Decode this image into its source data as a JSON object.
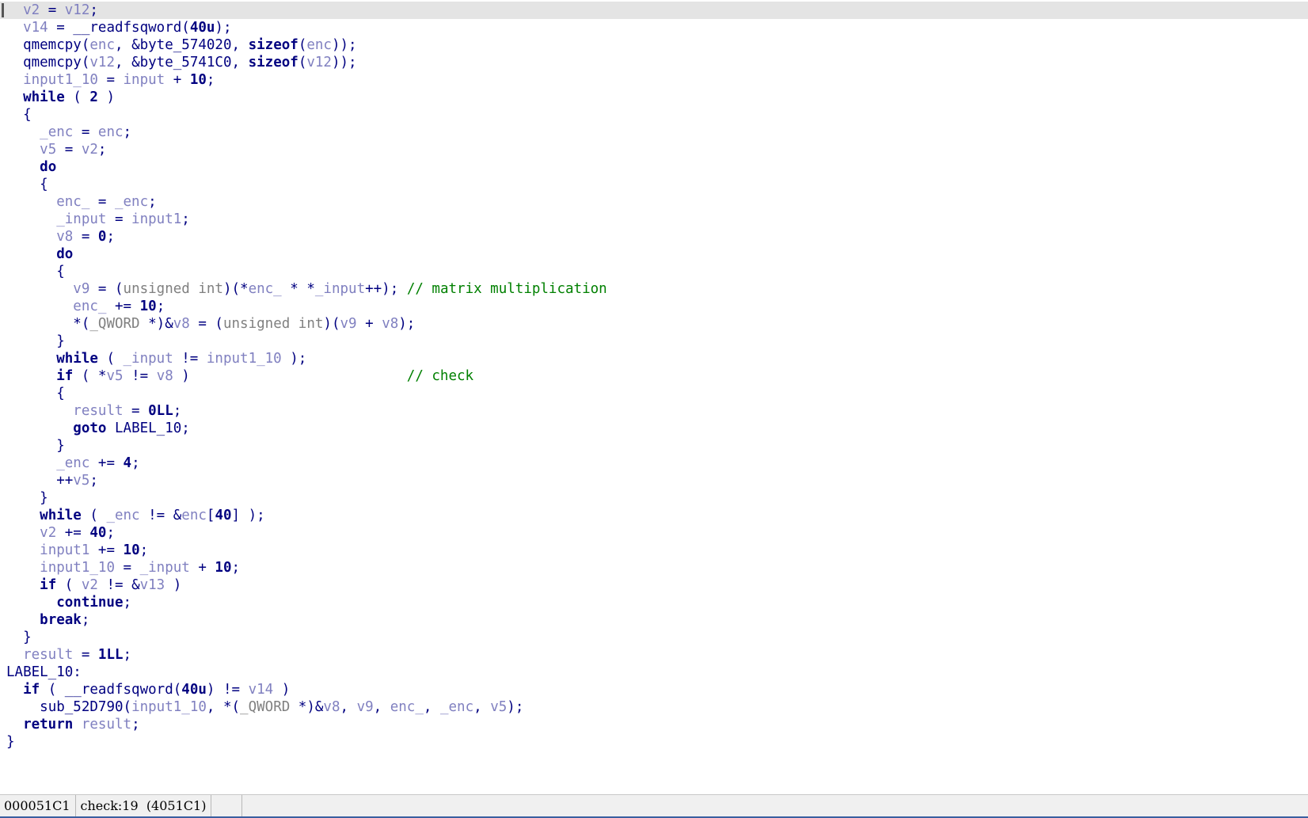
{
  "window": {
    "title": "IDA Pro - Pseudocode view",
    "background_color": "#ffffff",
    "current_line_highlight_color": "#e4e4e4"
  },
  "colors": {
    "default_text": "#000080",
    "local_variable": "#8080c0",
    "type": "#808080",
    "comment": "#008000",
    "keyword": "#000080",
    "status_bar_bg": "#f0f0f0",
    "status_bar_accent": "#3a5fa0"
  },
  "editor": {
    "current_line_index": 0,
    "caret_visible": true,
    "lines": [
      {
        "indent": 1,
        "tokens": [
          {
            "t": "var",
            "v": "v2"
          },
          {
            "t": "punct",
            "v": " = "
          },
          {
            "t": "var",
            "v": "v12"
          },
          {
            "t": "punct",
            "v": ";"
          }
        ]
      },
      {
        "indent": 1,
        "tokens": [
          {
            "t": "var",
            "v": "v14"
          },
          {
            "t": "punct",
            "v": " = "
          },
          {
            "t": "func",
            "v": "__readfsqword"
          },
          {
            "t": "punct",
            "v": "("
          },
          {
            "t": "num",
            "v": "40u"
          },
          {
            "t": "punct",
            "v": ");"
          }
        ]
      },
      {
        "indent": 1,
        "tokens": [
          {
            "t": "func",
            "v": "qmemcpy"
          },
          {
            "t": "punct",
            "v": "("
          },
          {
            "t": "var",
            "v": "enc"
          },
          {
            "t": "punct",
            "v": ", &"
          },
          {
            "t": "glob",
            "v": "byte_574020"
          },
          {
            "t": "punct",
            "v": ", "
          },
          {
            "t": "kw",
            "v": "sizeof"
          },
          {
            "t": "punct",
            "v": "("
          },
          {
            "t": "var",
            "v": "enc"
          },
          {
            "t": "punct",
            "v": "));"
          }
        ]
      },
      {
        "indent": 1,
        "tokens": [
          {
            "t": "func",
            "v": "qmemcpy"
          },
          {
            "t": "punct",
            "v": "("
          },
          {
            "t": "var",
            "v": "v12"
          },
          {
            "t": "punct",
            "v": ", &"
          },
          {
            "t": "glob",
            "v": "byte_5741C0"
          },
          {
            "t": "punct",
            "v": ", "
          },
          {
            "t": "kw",
            "v": "sizeof"
          },
          {
            "t": "punct",
            "v": "("
          },
          {
            "t": "var",
            "v": "v12"
          },
          {
            "t": "punct",
            "v": "));"
          }
        ]
      },
      {
        "indent": 1,
        "tokens": [
          {
            "t": "var",
            "v": "input1_10"
          },
          {
            "t": "punct",
            "v": " = "
          },
          {
            "t": "var",
            "v": "input"
          },
          {
            "t": "punct",
            "v": " + "
          },
          {
            "t": "num",
            "v": "10"
          },
          {
            "t": "punct",
            "v": ";"
          }
        ]
      },
      {
        "indent": 1,
        "tokens": [
          {
            "t": "kw",
            "v": "while"
          },
          {
            "t": "punct",
            "v": " ( "
          },
          {
            "t": "num",
            "v": "2"
          },
          {
            "t": "punct",
            "v": " )"
          }
        ]
      },
      {
        "indent": 1,
        "tokens": [
          {
            "t": "punct",
            "v": "{"
          }
        ]
      },
      {
        "indent": 2,
        "tokens": [
          {
            "t": "var",
            "v": "_enc"
          },
          {
            "t": "punct",
            "v": " = "
          },
          {
            "t": "var",
            "v": "enc"
          },
          {
            "t": "punct",
            "v": ";"
          }
        ]
      },
      {
        "indent": 2,
        "tokens": [
          {
            "t": "var",
            "v": "v5"
          },
          {
            "t": "punct",
            "v": " = "
          },
          {
            "t": "var",
            "v": "v2"
          },
          {
            "t": "punct",
            "v": ";"
          }
        ]
      },
      {
        "indent": 2,
        "tokens": [
          {
            "t": "kw",
            "v": "do"
          }
        ]
      },
      {
        "indent": 2,
        "tokens": [
          {
            "t": "punct",
            "v": "{"
          }
        ]
      },
      {
        "indent": 3,
        "tokens": [
          {
            "t": "var",
            "v": "enc_"
          },
          {
            "t": "punct",
            "v": " = "
          },
          {
            "t": "var",
            "v": "_enc"
          },
          {
            "t": "punct",
            "v": ";"
          }
        ]
      },
      {
        "indent": 3,
        "tokens": [
          {
            "t": "var",
            "v": "_input"
          },
          {
            "t": "punct",
            "v": " = "
          },
          {
            "t": "var",
            "v": "input1"
          },
          {
            "t": "punct",
            "v": ";"
          }
        ]
      },
      {
        "indent": 3,
        "tokens": [
          {
            "t": "var",
            "v": "v8"
          },
          {
            "t": "punct",
            "v": " = "
          },
          {
            "t": "num",
            "v": "0"
          },
          {
            "t": "punct",
            "v": ";"
          }
        ]
      },
      {
        "indent": 3,
        "tokens": [
          {
            "t": "kw",
            "v": "do"
          }
        ]
      },
      {
        "indent": 3,
        "tokens": [
          {
            "t": "punct",
            "v": "{"
          }
        ]
      },
      {
        "indent": 4,
        "comment": "// matrix multiplication",
        "comment_col": 48,
        "tokens": [
          {
            "t": "var",
            "v": "v9"
          },
          {
            "t": "punct",
            "v": " = ("
          },
          {
            "t": "type",
            "v": "unsigned int"
          },
          {
            "t": "punct",
            "v": ")(*"
          },
          {
            "t": "var",
            "v": "enc_"
          },
          {
            "t": "punct",
            "v": " * *"
          },
          {
            "t": "var",
            "v": "_input"
          },
          {
            "t": "punct",
            "v": "++);"
          }
        ]
      },
      {
        "indent": 4,
        "tokens": [
          {
            "t": "var",
            "v": "enc_"
          },
          {
            "t": "punct",
            "v": " += "
          },
          {
            "t": "num",
            "v": "10"
          },
          {
            "t": "punct",
            "v": ";"
          }
        ]
      },
      {
        "indent": 4,
        "tokens": [
          {
            "t": "punct",
            "v": "*("
          },
          {
            "t": "type",
            "v": "_QWORD"
          },
          {
            "t": "punct",
            "v": " *)&"
          },
          {
            "t": "var",
            "v": "v8"
          },
          {
            "t": "punct",
            "v": " = ("
          },
          {
            "t": "type",
            "v": "unsigned int"
          },
          {
            "t": "punct",
            "v": ")("
          },
          {
            "t": "var",
            "v": "v9"
          },
          {
            "t": "punct",
            "v": " + "
          },
          {
            "t": "var",
            "v": "v8"
          },
          {
            "t": "punct",
            "v": ");"
          }
        ]
      },
      {
        "indent": 3,
        "tokens": [
          {
            "t": "punct",
            "v": "}"
          }
        ]
      },
      {
        "indent": 3,
        "tokens": [
          {
            "t": "kw",
            "v": "while"
          },
          {
            "t": "punct",
            "v": " ( "
          },
          {
            "t": "var",
            "v": "_input"
          },
          {
            "t": "punct",
            "v": " != "
          },
          {
            "t": "var",
            "v": "input1_10"
          },
          {
            "t": "punct",
            "v": " );"
          }
        ]
      },
      {
        "indent": 3,
        "comment": "// check",
        "comment_col": 48,
        "tokens": [
          {
            "t": "kw",
            "v": "if"
          },
          {
            "t": "punct",
            "v": " ( *"
          },
          {
            "t": "var",
            "v": "v5"
          },
          {
            "t": "punct",
            "v": " != "
          },
          {
            "t": "var",
            "v": "v8"
          },
          {
            "t": "punct",
            "v": " )"
          }
        ]
      },
      {
        "indent": 3,
        "tokens": [
          {
            "t": "punct",
            "v": "{"
          }
        ]
      },
      {
        "indent": 4,
        "tokens": [
          {
            "t": "var",
            "v": "result"
          },
          {
            "t": "punct",
            "v": " = "
          },
          {
            "t": "num",
            "v": "0LL"
          },
          {
            "t": "punct",
            "v": ";"
          }
        ]
      },
      {
        "indent": 4,
        "tokens": [
          {
            "t": "kw",
            "v": "goto"
          },
          {
            "t": "punct",
            "v": " "
          },
          {
            "t": "label",
            "v": "LABEL_10"
          },
          {
            "t": "punct",
            "v": ";"
          }
        ]
      },
      {
        "indent": 3,
        "tokens": [
          {
            "t": "punct",
            "v": "}"
          }
        ]
      },
      {
        "indent": 3,
        "tokens": [
          {
            "t": "var",
            "v": "_enc"
          },
          {
            "t": "punct",
            "v": " += "
          },
          {
            "t": "num",
            "v": "4"
          },
          {
            "t": "punct",
            "v": ";"
          }
        ]
      },
      {
        "indent": 3,
        "tokens": [
          {
            "t": "punct",
            "v": "++"
          },
          {
            "t": "var",
            "v": "v5"
          },
          {
            "t": "punct",
            "v": ";"
          }
        ]
      },
      {
        "indent": 2,
        "tokens": [
          {
            "t": "punct",
            "v": "}"
          }
        ]
      },
      {
        "indent": 2,
        "tokens": [
          {
            "t": "kw",
            "v": "while"
          },
          {
            "t": "punct",
            "v": " ( "
          },
          {
            "t": "var",
            "v": "_enc"
          },
          {
            "t": "punct",
            "v": " != &"
          },
          {
            "t": "var",
            "v": "enc"
          },
          {
            "t": "punct",
            "v": "["
          },
          {
            "t": "num",
            "v": "40"
          },
          {
            "t": "punct",
            "v": "] );"
          }
        ]
      },
      {
        "indent": 2,
        "tokens": [
          {
            "t": "var",
            "v": "v2"
          },
          {
            "t": "punct",
            "v": " += "
          },
          {
            "t": "num",
            "v": "40"
          },
          {
            "t": "punct",
            "v": ";"
          }
        ]
      },
      {
        "indent": 2,
        "tokens": [
          {
            "t": "var",
            "v": "input1"
          },
          {
            "t": "punct",
            "v": " += "
          },
          {
            "t": "num",
            "v": "10"
          },
          {
            "t": "punct",
            "v": ";"
          }
        ]
      },
      {
        "indent": 2,
        "tokens": [
          {
            "t": "var",
            "v": "input1_10"
          },
          {
            "t": "punct",
            "v": " = "
          },
          {
            "t": "var",
            "v": "_input"
          },
          {
            "t": "punct",
            "v": " + "
          },
          {
            "t": "num",
            "v": "10"
          },
          {
            "t": "punct",
            "v": ";"
          }
        ]
      },
      {
        "indent": 2,
        "tokens": [
          {
            "t": "kw",
            "v": "if"
          },
          {
            "t": "punct",
            "v": " ( "
          },
          {
            "t": "var",
            "v": "v2"
          },
          {
            "t": "punct",
            "v": " != &"
          },
          {
            "t": "var",
            "v": "v13"
          },
          {
            "t": "punct",
            "v": " )"
          }
        ]
      },
      {
        "indent": 3,
        "tokens": [
          {
            "t": "kw",
            "v": "continue"
          },
          {
            "t": "punct",
            "v": ";"
          }
        ]
      },
      {
        "indent": 2,
        "tokens": [
          {
            "t": "kw",
            "v": "break"
          },
          {
            "t": "punct",
            "v": ";"
          }
        ]
      },
      {
        "indent": 1,
        "tokens": [
          {
            "t": "punct",
            "v": "}"
          }
        ]
      },
      {
        "indent": 1,
        "tokens": [
          {
            "t": "var",
            "v": "result"
          },
          {
            "t": "punct",
            "v": " = "
          },
          {
            "t": "num",
            "v": "1LL"
          },
          {
            "t": "punct",
            "v": ";"
          }
        ]
      },
      {
        "indent": 0,
        "tokens": [
          {
            "t": "label",
            "v": "LABEL_10"
          },
          {
            "t": "punct",
            "v": ":"
          }
        ]
      },
      {
        "indent": 1,
        "tokens": [
          {
            "t": "kw",
            "v": "if"
          },
          {
            "t": "punct",
            "v": " ( "
          },
          {
            "t": "func",
            "v": "__readfsqword"
          },
          {
            "t": "punct",
            "v": "("
          },
          {
            "t": "num",
            "v": "40u"
          },
          {
            "t": "punct",
            "v": ") != "
          },
          {
            "t": "var",
            "v": "v14"
          },
          {
            "t": "punct",
            "v": " )"
          }
        ]
      },
      {
        "indent": 2,
        "tokens": [
          {
            "t": "func",
            "v": "sub_52D790"
          },
          {
            "t": "punct",
            "v": "("
          },
          {
            "t": "var",
            "v": "input1_10"
          },
          {
            "t": "punct",
            "v": ", *("
          },
          {
            "t": "type",
            "v": "_QWORD"
          },
          {
            "t": "punct",
            "v": " *)&"
          },
          {
            "t": "var",
            "v": "v8"
          },
          {
            "t": "punct",
            "v": ", "
          },
          {
            "t": "var",
            "v": "v9"
          },
          {
            "t": "punct",
            "v": ", "
          },
          {
            "t": "var",
            "v": "enc_"
          },
          {
            "t": "punct",
            "v": ", "
          },
          {
            "t": "var",
            "v": "_enc"
          },
          {
            "t": "punct",
            "v": ", "
          },
          {
            "t": "var",
            "v": "v5"
          },
          {
            "t": "punct",
            "v": ");"
          }
        ]
      },
      {
        "indent": 1,
        "tokens": [
          {
            "t": "kw",
            "v": "return"
          },
          {
            "t": "punct",
            "v": " "
          },
          {
            "t": "var",
            "v": "result"
          },
          {
            "t": "punct",
            "v": ";"
          }
        ]
      },
      {
        "indent": 0,
        "tokens": [
          {
            "t": "punct",
            "v": "}"
          }
        ]
      }
    ]
  },
  "status_bar": {
    "address": "000051C1",
    "location": "check:19  (4051C1)",
    "extra": ""
  }
}
